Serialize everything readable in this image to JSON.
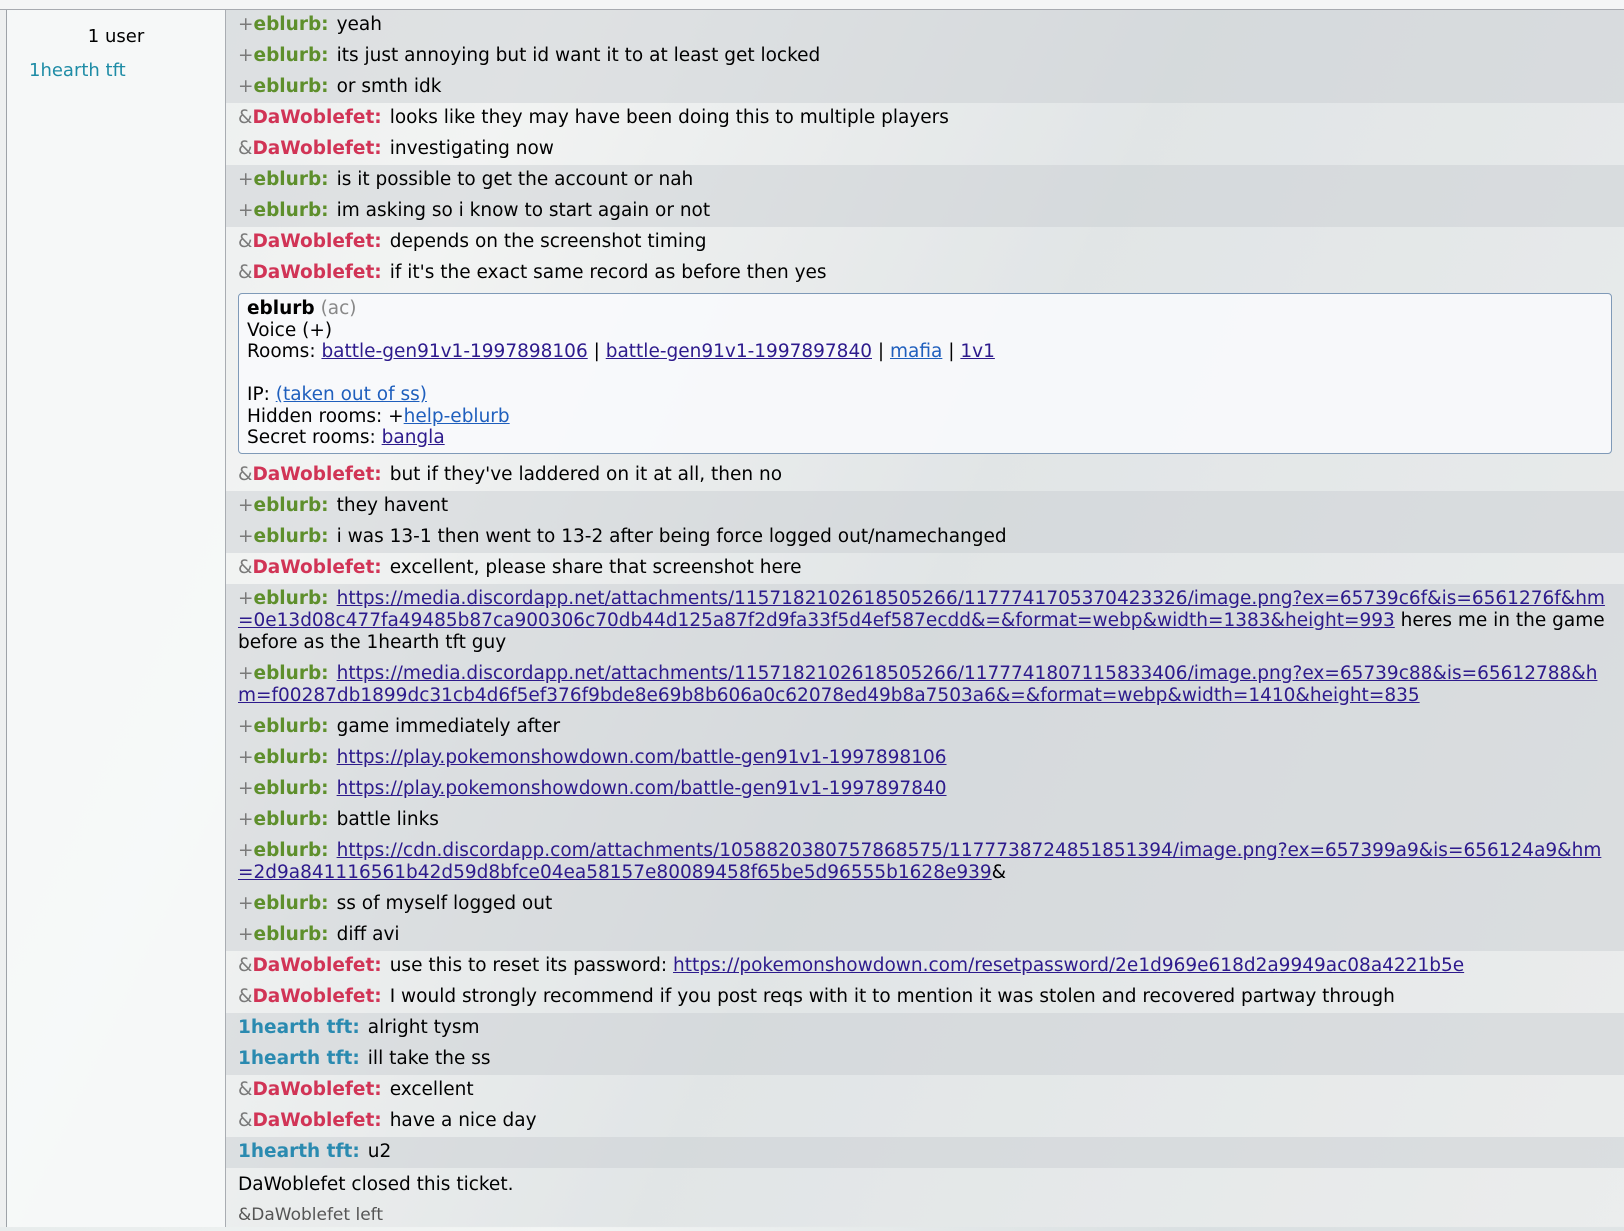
{
  "userlist": {
    "count_label": "1 user",
    "users": [
      "1hearth tft"
    ]
  },
  "messages": [
    {
      "sym": "+",
      "name": "eblurb",
      "color": "eblurb",
      "tint": true,
      "parts": [
        {
          "t": "yeah"
        }
      ]
    },
    {
      "sym": "+",
      "name": "eblurb",
      "color": "eblurb",
      "tint": true,
      "parts": [
        {
          "t": "its just annoying but id want it to at least get locked"
        }
      ]
    },
    {
      "sym": "+",
      "name": "eblurb",
      "color": "eblurb",
      "tint": true,
      "parts": [
        {
          "t": "or smth idk"
        }
      ]
    },
    {
      "sym": "&",
      "name": "DaWoblefet",
      "color": "dawob",
      "tint": false,
      "parts": [
        {
          "t": "looks like they may have been doing this to multiple players"
        }
      ]
    },
    {
      "sym": "&",
      "name": "DaWoblefet",
      "color": "dawob",
      "tint": false,
      "parts": [
        {
          "t": "investigating now"
        }
      ]
    },
    {
      "sym": "+",
      "name": "eblurb",
      "color": "eblurb",
      "tint": true,
      "parts": [
        {
          "t": "is it possible to get the account or nah"
        }
      ]
    },
    {
      "sym": "+",
      "name": "eblurb",
      "color": "eblurb",
      "tint": true,
      "parts": [
        {
          "t": "im asking so i know to start again or not"
        }
      ]
    },
    {
      "sym": "&",
      "name": "DaWoblefet",
      "color": "dawob",
      "tint": false,
      "parts": [
        {
          "t": "depends on the screenshot timing"
        }
      ]
    },
    {
      "sym": "&",
      "name": "DaWoblefet",
      "color": "dawob",
      "tint": false,
      "parts": [
        {
          "t": "if it's the exact same record as before then yes"
        }
      ]
    },
    {
      "type": "infobox"
    },
    {
      "sym": "&",
      "name": "DaWoblefet",
      "color": "dawob",
      "tint": false,
      "parts": [
        {
          "t": "but if they've laddered on it at all, then no"
        }
      ]
    },
    {
      "sym": "+",
      "name": "eblurb",
      "color": "eblurb",
      "tint": true,
      "parts": [
        {
          "t": "they havent"
        }
      ]
    },
    {
      "sym": "+",
      "name": "eblurb",
      "color": "eblurb",
      "tint": true,
      "parts": [
        {
          "t": "i was 13-1 then went to 13-2 after being force logged out/namechanged"
        }
      ]
    },
    {
      "sym": "&",
      "name": "DaWoblefet",
      "color": "dawob",
      "tint": false,
      "parts": [
        {
          "t": "excellent, please share that screenshot here"
        }
      ]
    },
    {
      "sym": "+",
      "name": "eblurb",
      "color": "eblurb",
      "tint": true,
      "parts": [
        {
          "l": "https://media.discordapp.net/attachments/1157182102618505266/1177741705370423326/image.png?ex=65739c6f&is=6561276f&hm=0e13d08c477fa49485b87ca900306c70db44d125a87f2d9fa33f5d4ef587ecdd&=&format=webp&width=1383&height=993"
        },
        {
          "t": " heres me in the game before as the 1hearth tft guy"
        }
      ]
    },
    {
      "sym": "+",
      "name": "eblurb",
      "color": "eblurb",
      "tint": true,
      "parts": [
        {
          "l": "https://media.discordapp.net/attachments/1157182102618505266/1177741807115833406/image.png?ex=65739c88&is=65612788&hm=f00287db1899dc31cb4d6f5ef376f9bde8e69b8b606a0c62078ed49b8a7503a6&=&format=webp&width=1410&height=835"
        }
      ]
    },
    {
      "sym": "+",
      "name": "eblurb",
      "color": "eblurb",
      "tint": true,
      "parts": [
        {
          "t": "game immediately after"
        }
      ]
    },
    {
      "sym": "+",
      "name": "eblurb",
      "color": "eblurb",
      "tint": true,
      "parts": [
        {
          "l": "https://play.pokemonshowdown.com/battle-gen91v1-1997898106"
        }
      ]
    },
    {
      "sym": "+",
      "name": "eblurb",
      "color": "eblurb",
      "tint": true,
      "parts": [
        {
          "l": "https://play.pokemonshowdown.com/battle-gen91v1-1997897840"
        }
      ]
    },
    {
      "sym": "+",
      "name": "eblurb",
      "color": "eblurb",
      "tint": true,
      "parts": [
        {
          "t": "battle links"
        }
      ]
    },
    {
      "sym": "+",
      "name": "eblurb",
      "color": "eblurb",
      "tint": true,
      "parts": [
        {
          "l": "https://cdn.discordapp.com/attachments/1058820380757868575/1177738724851851394/image.png?ex=657399a9&is=656124a9&hm=2d9a841116561b42d59d8bfce04ea58157e80089458f65be5d96555b1628e939"
        },
        {
          "t": "&"
        }
      ]
    },
    {
      "sym": "+",
      "name": "eblurb",
      "color": "eblurb",
      "tint": true,
      "parts": [
        {
          "t": "ss of myself logged out"
        }
      ]
    },
    {
      "sym": "+",
      "name": "eblurb",
      "color": "eblurb",
      "tint": true,
      "parts": [
        {
          "t": "diff avi"
        }
      ]
    },
    {
      "sym": "&",
      "name": "DaWoblefet",
      "color": "dawob",
      "tint": false,
      "parts": [
        {
          "t": "use this to reset its password: "
        },
        {
          "l": "https://pokemonshowdown.com/resetpassword/2e1d969e618d2a9949ac08a4221b5e"
        }
      ]
    },
    {
      "sym": "&",
      "name": "DaWoblefet",
      "color": "dawob",
      "tint": false,
      "parts": [
        {
          "t": "I would strongly recommend if you post reqs with it to mention it was stolen and recovered partway through"
        }
      ]
    },
    {
      "sym": "",
      "name": "1hearth tft",
      "color": "hearth",
      "tint": true,
      "parts": [
        {
          "t": "alright tysm"
        }
      ]
    },
    {
      "sym": "",
      "name": "1hearth tft",
      "color": "hearth",
      "tint": true,
      "parts": [
        {
          "t": "ill take the ss"
        }
      ]
    },
    {
      "sym": "&",
      "name": "DaWoblefet",
      "color": "dawob",
      "tint": false,
      "parts": [
        {
          "t": "excellent"
        }
      ]
    },
    {
      "sym": "&",
      "name": "DaWoblefet",
      "color": "dawob",
      "tint": false,
      "parts": [
        {
          "t": "have a nice day"
        }
      ]
    },
    {
      "sym": "",
      "name": "1hearth tft",
      "color": "hearth",
      "tint": true,
      "parts": [
        {
          "t": "u2"
        }
      ]
    },
    {
      "type": "system",
      "text": "DaWoblefet closed this ticket."
    },
    {
      "type": "leave",
      "text": "&DaWoblefet left"
    }
  ],
  "infobox": {
    "name": "eblurb",
    "sub": "(ac)",
    "group_line": "Voice (+)",
    "rooms_label": "Rooms: ",
    "rooms": [
      "battle-gen91v1-1997898106",
      "battle-gen91v1-1997897840",
      "mafia",
      "1v1"
    ],
    "ip_label": "IP: ",
    "ip_value": "(taken out of ss)",
    "hidden_label": "Hidden rooms: +",
    "hidden_room": "help-eblurb",
    "secret_label": "Secret rooms: ",
    "secret_room": "bangla"
  },
  "colors": {
    "eblurb": "#5e8f2c",
    "dawob": "#d13456",
    "hearth": "#2a8ab0"
  }
}
